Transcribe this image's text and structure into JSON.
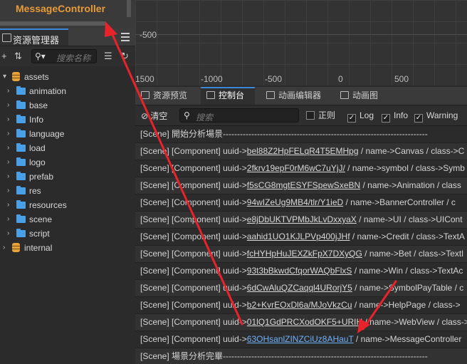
{
  "node_header": {
    "title": "MessageController"
  },
  "scene": {
    "y_label": "-500",
    "x_labels": [
      "1500",
      "-1000",
      "-500",
      "0",
      "500"
    ]
  },
  "assets": {
    "tab_label": "资源管理器",
    "search_placeholder": "搜索名称",
    "tree": [
      {
        "name": "assets",
        "kind": "db",
        "expanded": true
      },
      {
        "name": "animation",
        "kind": "folder"
      },
      {
        "name": "base",
        "kind": "folder"
      },
      {
        "name": "Info",
        "kind": "folder"
      },
      {
        "name": "language",
        "kind": "folder"
      },
      {
        "name": "load",
        "kind": "folder"
      },
      {
        "name": "logo",
        "kind": "folder"
      },
      {
        "name": "prefab",
        "kind": "folder"
      },
      {
        "name": "res",
        "kind": "folder"
      },
      {
        "name": "resources",
        "kind": "folder"
      },
      {
        "name": "scene",
        "kind": "folder"
      },
      {
        "name": "script",
        "kind": "folder"
      },
      {
        "name": "internal",
        "kind": "db",
        "expanded": false
      }
    ]
  },
  "console": {
    "tabs": [
      "资源预览",
      "控制台",
      "动画编辑器",
      "动画图"
    ],
    "active_tab": 1,
    "clear_label": "清空",
    "search_placeholder": "搜索",
    "filters": [
      {
        "label": "正则",
        "checked": false
      },
      {
        "label": "Log",
        "checked": true
      },
      {
        "label": "Info",
        "checked": true
      },
      {
        "label": "Warning",
        "checked": true
      }
    ],
    "logs": [
      {
        "prefix": "[Scene] 開始分析場景------------------------------------------------------------------------",
        "uuid": "",
        "suffix": ""
      },
      {
        "prefix": "[Scene] [Component] uuid->",
        "uuid": "bel88Z2HpFELqR4T5EMHpg",
        "suffix": " / name->Canvas / class->C"
      },
      {
        "prefix": "[Scene] [Component] uuid->",
        "uuid": "2fkrv19epF0rM6wC7uYjJ/",
        "suffix": " / name->symbol / class->Symb"
      },
      {
        "prefix": "[Scene] [Component] uuid->",
        "uuid": "f5sCG8mgtESYFSpewSxeBN",
        "suffix": " / name->Animation / class"
      },
      {
        "prefix": "[Scene] [Component] uuid->",
        "uuid": "94wIZeUg9MB4/tlr/Y1ieD",
        "suffix": " / name->BannerController / c"
      },
      {
        "prefix": "[Scene] [Component] uuid->",
        "uuid": "e8jDbUKTVPMbJkLvDxxyaX",
        "suffix": " / name->UI / class->UICont"
      },
      {
        "prefix": "[Scene] [Component] uuid->",
        "uuid": "aahid1UO1KJLPVp400jJHf",
        "suffix": " / name->Credit / class->TextA"
      },
      {
        "prefix": "[Scene] [Component] uuid->",
        "uuid": "fcHYHpHuJEXZkFpX7DXyQG",
        "suffix": " / name->Bet / class->Textl"
      },
      {
        "prefix": "[Scene] [Component] uuid->",
        "uuid": "93t3bBkwdCfqorWAQbFlxS",
        "suffix": " / name->Win / class->TextAc"
      },
      {
        "prefix": "[Scene] [Component] uuid->",
        "uuid": "6dCwAluQZCaqql4URorjY5",
        "suffix": " / name->SymbolPayTable / c"
      },
      {
        "prefix": "[Scene] [Component] uuid->",
        "uuid": "b2+KvrEOxDl6a/MJoVkzCu",
        "suffix": " / name->HelpPage / class->"
      },
      {
        "prefix": "[Scene] [Component] uuid->",
        "uuid": "01lQ1GdPRCXodOKF5+URIH",
        "suffix": " / name->WebView / class->"
      },
      {
        "prefix": "[Scene] [Component] uuid->",
        "uuid": "63OHsanlZINZCiUz8AHauT",
        "suffix": " / name->MessageController",
        "highlight": true
      },
      {
        "prefix": "[Scene] 場景分析完畢------------------------------------------------------------------------",
        "uuid": "",
        "suffix": ""
      }
    ]
  },
  "colors": {
    "accent": "#3d87d8",
    "annotation": "#e8232a",
    "node_title": "#e79a3a",
    "folder": "#4aa0e6",
    "db": "#e7a23a"
  }
}
